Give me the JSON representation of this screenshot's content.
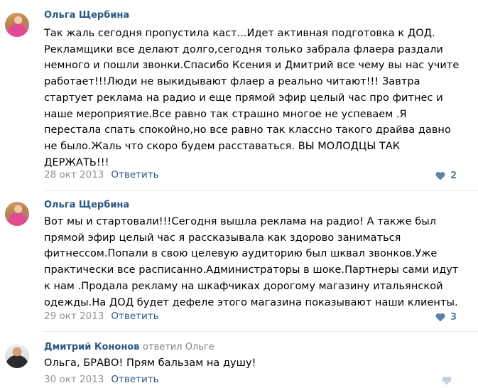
{
  "comments": [
    {
      "author": "Ольга Щербина",
      "text": "Так жаль сегодня пропустила каст...Идет активная подготовка к ДОД.\nРекламщики все делают долго,сегодня только забрала флаера раздали\nнемного и пошли звонки.Спасибо Ксения и Дмитрий все чему вы нас учите\nработает!!!Люди не выкидывают флаер а реально читают!!! Завтра\nстартует реклама на радио и еще прямой эфир целый час про фитнес и\nнаше мероприятие.Все равно так страшно многое не успеваем .Я\nперестала спать спокойно,но все равно так классно такого драйва давно\nне было.Жаль что скоро будем расставаться. ВЫ МОЛОДЦЫ ТАК\nДЕРЖАТЬ!!!",
      "date": "28 окт 2013",
      "reply": "Ответить",
      "likes": "2"
    },
    {
      "author": "Ольга Щербина",
      "text": "Вот мы и стартовали!!!Сегодня вышла реклама на радио! А также был\nпрямой эфир целый час я рассказывала как здорово заниматься\nфитнессом.Попали в свою целевую аудиторию был шквал звонков.Уже\nпрактически все расписанно.Администраторы в шоке.Партнеры сами идут\nк нам .Продала рекламу на шкафчиках дорогому магазину итальянской\nодежды.На ДОД будет дефеле этого магазина показывают наши клиенты.",
      "date": "29 окт 2013",
      "reply": "Ответить",
      "likes": "3"
    },
    {
      "author": "Дмитрий Кононов",
      "replied_to": "ответил Ольге",
      "text": "Ольга, БРАВО! Прям бальзам на душу!",
      "date": "30 окт 2013",
      "reply": "Ответить",
      "likes": ""
    }
  ],
  "icons": {
    "like": "heart-icon",
    "avatar": "avatar"
  },
  "colors": {
    "link": "#2a5885",
    "muted": "#939393",
    "like_active": "#5e81a8",
    "like_inactive": "#c5d0db",
    "divider": "#e7e8ec"
  }
}
